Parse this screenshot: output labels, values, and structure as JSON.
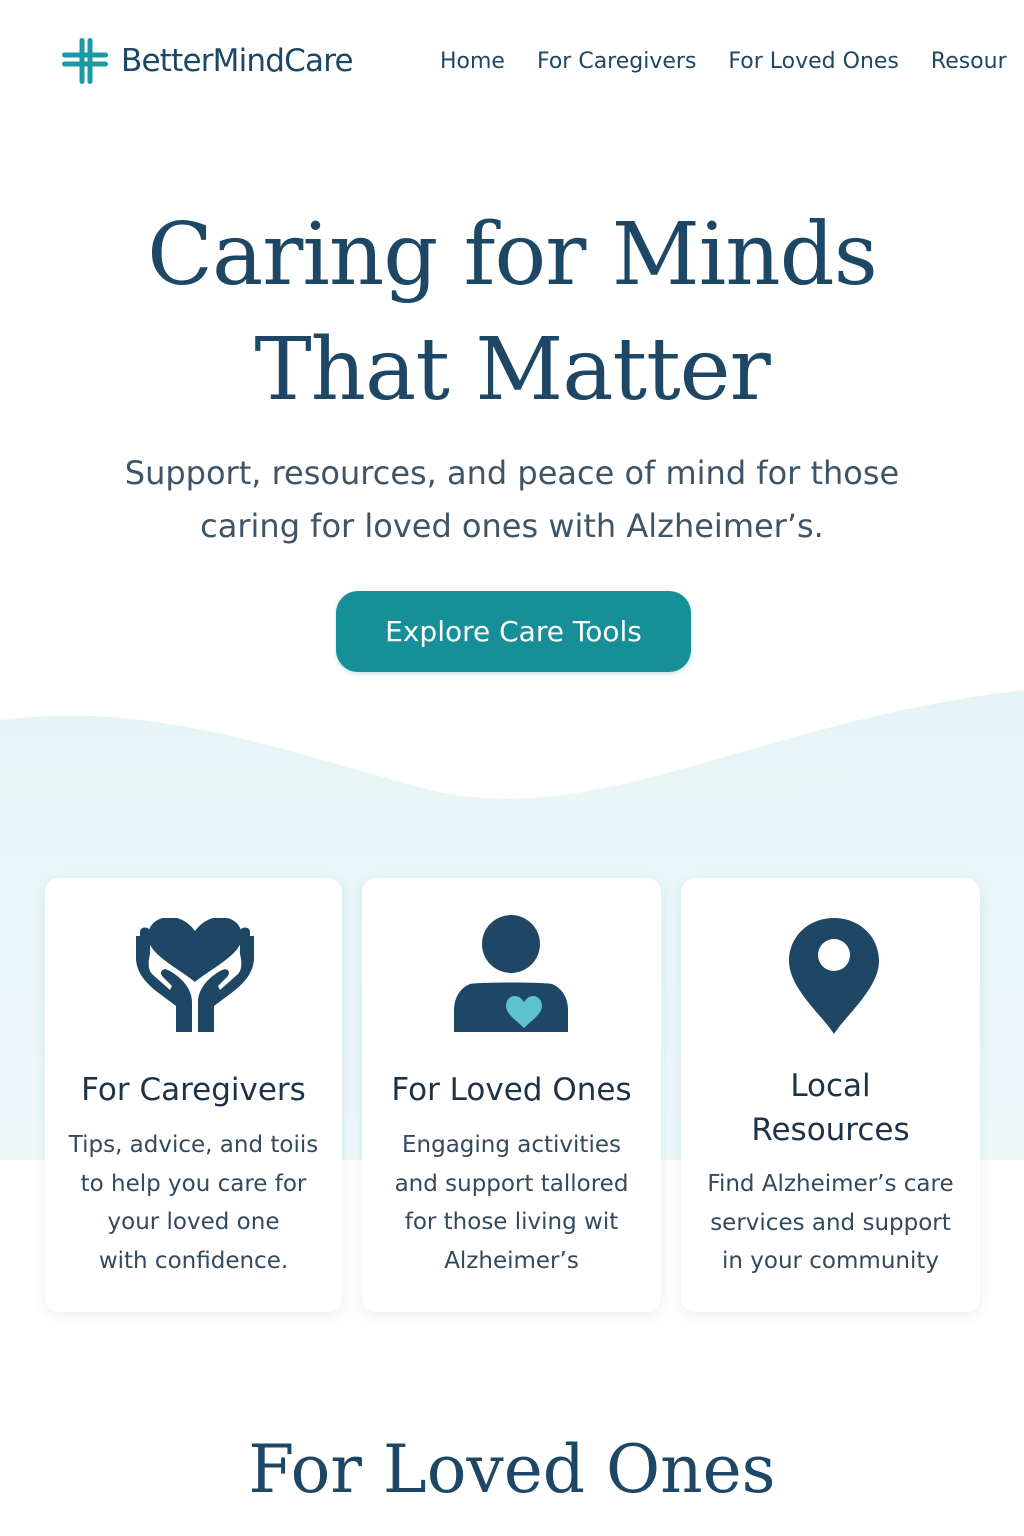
{
  "header": {
    "logo_text": "BetterMindCare",
    "nav": [
      "Home",
      "For Caregivers",
      "For Loved Ones",
      "Resour"
    ]
  },
  "hero": {
    "title_lines": [
      "Caring for Minds",
      "That Matter"
    ],
    "subtitle_lines": [
      "Support, resources, and peace of mind for those",
      "caring for loved ones with Alzheimer’s."
    ],
    "cta_label": "Explore Care Tools"
  },
  "cards": [
    {
      "icon": "caring-hands-heart-icon",
      "title_lines": [
        "For Caregivers"
      ],
      "text_lines": [
        "Tips, advice, and toiis",
        "to help you care for",
        "your loved one",
        "with confidence."
      ]
    },
    {
      "icon": "person-heart-icon",
      "title_lines": [
        "For Loved Ones"
      ],
      "text_lines": [
        "Engaging activities",
        "and support  tallored",
        "for those living wit",
        "Alzheimer’s"
      ]
    },
    {
      "icon": "location-pin-icon",
      "title_lines": [
        "Local",
        "Resources"
      ],
      "text_lines": [
        "Find Alzheimer’s care",
        "services and support",
        "in your community"
      ]
    }
  ],
  "section": {
    "heading": "For  Loved Ones"
  },
  "colors": {
    "navy": "#1d4764",
    "teal": "#168f98",
    "light_teal": "#5cc2cc",
    "wave": "#e8f6f7"
  }
}
